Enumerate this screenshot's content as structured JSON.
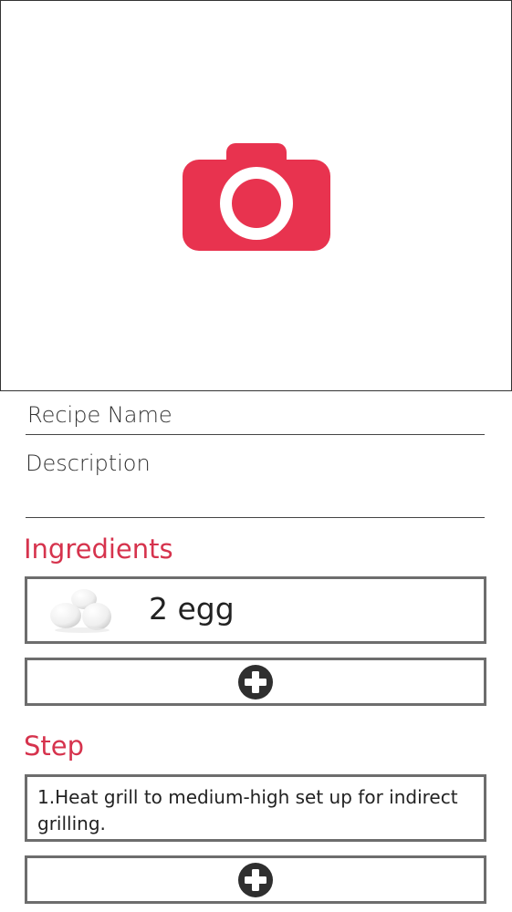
{
  "form": {
    "recipe_name_placeholder": "Recipe Name",
    "description_placeholder": "Description"
  },
  "ingredients": {
    "title": "Ingredients",
    "items": [
      {
        "text": "2 egg",
        "image_icon": "eggs-image"
      }
    ],
    "add_icon": "plus-circle-icon"
  },
  "steps": {
    "title": "Step",
    "items": [
      {
        "text": "1.Heat grill to medium-high set up for indirect grilling."
      }
    ],
    "add_icon": "plus-circle-icon"
  },
  "photo": {
    "icon": "camera-icon"
  },
  "colors": {
    "accent": "#e8334f",
    "heading": "#d6334d",
    "border": "#6d6d6d",
    "icon_dark": "#2f2f2f"
  }
}
